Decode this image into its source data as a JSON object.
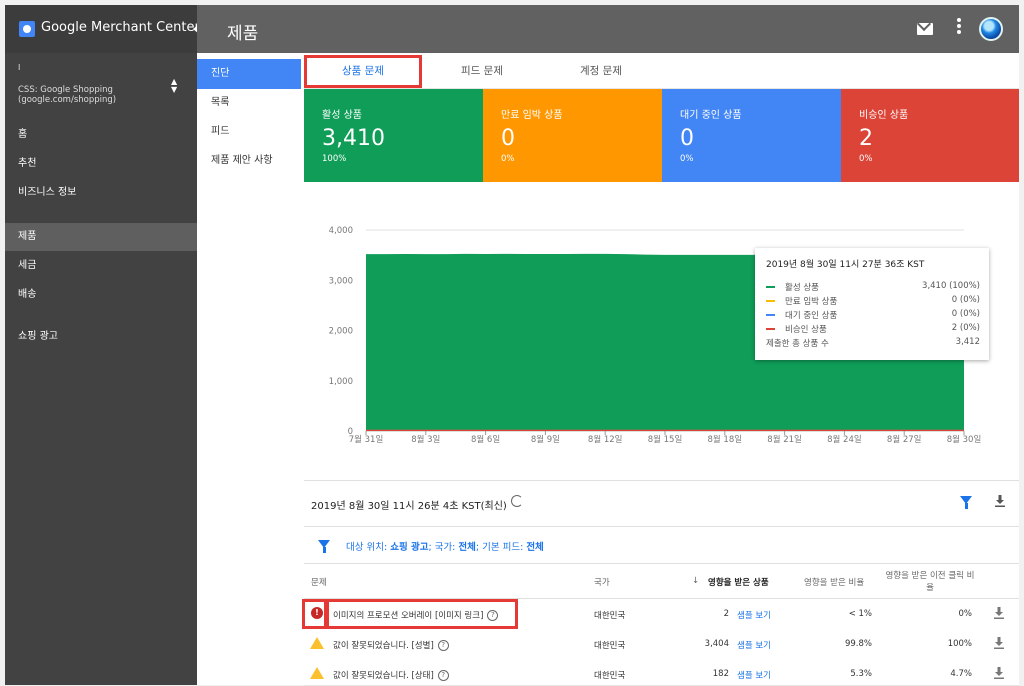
{
  "header": {
    "brand": "Google Merchant Center",
    "title": "제품"
  },
  "account": {
    "line1": "I",
    "line2": "CSS: Google Shopping (google.com/shopping)"
  },
  "leftnav": {
    "items": [
      {
        "label": "홈"
      },
      {
        "label": "추천"
      },
      {
        "label": "비즈니스 정보"
      },
      {
        "label": "제품",
        "active": true
      },
      {
        "label": "세금"
      },
      {
        "label": "배송"
      },
      {
        "label": "쇼핑 광고"
      }
    ]
  },
  "subnav": {
    "items": [
      {
        "label": "진단",
        "active": true
      },
      {
        "label": "목록"
      },
      {
        "label": "피드"
      },
      {
        "label": "제품 제안 사항"
      }
    ]
  },
  "tabs": [
    {
      "label": "상품 문제",
      "active": true
    },
    {
      "label": "피드 문제"
    },
    {
      "label": "계정 문제"
    }
  ],
  "cards": [
    {
      "label": "활성 상품",
      "value": "3,410",
      "pct": "100%",
      "color": "#0f9d58"
    },
    {
      "label": "만료 임박 상품",
      "value": "0",
      "pct": "0%",
      "color": "#ff9800"
    },
    {
      "label": "대기 중인 상품",
      "value": "0",
      "pct": "0%",
      "color": "#4285f4"
    },
    {
      "label": "비승인 상품",
      "value": "2",
      "pct": "0%",
      "color": "#db4437"
    }
  ],
  "chart_data": {
    "type": "area",
    "x": [
      "7월 31일",
      "8월 1일",
      "8월 2일",
      "8월 3일",
      "8월 4일",
      "8월 5일",
      "8월 6일",
      "8월 7일",
      "8월 8일",
      "8월 9일",
      "8월 10일",
      "8월 11일",
      "8월 12일",
      "8월 13일",
      "8월 14일",
      "8월 15일",
      "8월 16일",
      "8월 17일",
      "8월 18일",
      "8월 19일",
      "8월 20일",
      "8월 21일",
      "8월 22일",
      "8월 23일",
      "8월 24일",
      "8월 25일",
      "8월 26일",
      "8월 27일",
      "8월 28일",
      "8월 29일",
      "8월 30일"
    ],
    "x_ticks": [
      "7월 31일",
      "8월 3일",
      "8월 6일",
      "8월 9일",
      "8월 12일",
      "8월 15일",
      "8월 18일",
      "8월 21일",
      "8월 24일",
      "8월 27일",
      "8월 30일"
    ],
    "series": [
      {
        "name": "활성 상품",
        "color": "#0f9d58",
        "values": [
          3520,
          3520,
          3522,
          3520,
          3521,
          3525,
          3523,
          3524,
          3522,
          3522,
          3523,
          3524,
          3525,
          3520,
          3510,
          3505,
          3505,
          3505,
          3506,
          3505,
          3505,
          3505,
          3505,
          3505,
          3505,
          3505,
          3505,
          3505,
          3505,
          3505,
          3410
        ]
      },
      {
        "name": "만료 임박 상품",
        "color": "#fbbc04",
        "values": [
          0,
          0,
          0,
          0,
          0,
          0,
          0,
          0,
          0,
          0,
          0,
          0,
          0,
          0,
          0,
          0,
          0,
          0,
          0,
          0,
          0,
          0,
          0,
          0,
          0,
          0,
          0,
          0,
          0,
          0,
          0
        ]
      },
      {
        "name": "대기 중인 상품",
        "color": "#4285f4",
        "values": [
          0,
          0,
          0,
          0,
          0,
          0,
          0,
          0,
          0,
          0,
          0,
          0,
          0,
          0,
          0,
          0,
          0,
          0,
          0,
          0,
          0,
          0,
          0,
          0,
          0,
          0,
          0,
          0,
          0,
          0,
          0
        ]
      },
      {
        "name": "비승인 상품",
        "color": "#db4437",
        "values": [
          2,
          2,
          2,
          2,
          2,
          2,
          2,
          2,
          2,
          2,
          2,
          2,
          2,
          2,
          2,
          2,
          2,
          2,
          2,
          2,
          2,
          2,
          2,
          2,
          2,
          2,
          2,
          2,
          2,
          2,
          2
        ]
      }
    ],
    "y_ticks": [
      "0",
      "1,000",
      "2,000",
      "3,000",
      "4,000"
    ],
    "ylim": [
      0,
      4000
    ],
    "grid": true
  },
  "tooltip": {
    "title": "2019년 8월 30일 11시 27분 36조 KST",
    "rows": [
      {
        "label": "활성 상품",
        "value": "3,410 (100%)",
        "color": "#0f9d58"
      },
      {
        "label": "만료 임박 상품",
        "value": "0 (0%)",
        "color": "#fbbc04"
      },
      {
        "label": "대기 중인 상품",
        "value": "0 (0%)",
        "color": "#4285f4"
      },
      {
        "label": "비승인 상품",
        "value": "2 (0%)",
        "color": "#db4437"
      },
      {
        "label": "제출한 총 상품 수",
        "value": "3,412",
        "color": ""
      }
    ]
  },
  "report": {
    "timestamp": "2019년 8월 30일 11시 26분 4초 KST(최신)",
    "filter_prefix": "대상 위치: ",
    "filter_dest": "쇼핑 광고",
    "filter_country_label": "; 국가: ",
    "filter_country": "전체",
    "filter_feed_label": "; 기본 피드: ",
    "filter_feed": "전체"
  },
  "table": {
    "headers": {
      "issue": "문제",
      "country": "국가",
      "affected": "영향을 받은 상품",
      "affected_ratio": "영향을 받은 비율",
      "prev_click_ratio": "영향을 받은 이전 클릭 비율"
    },
    "sample_label": "샘플 보기",
    "rows": [
      {
        "severity": "error",
        "issue": "이미지의 프로모션 오버레이 [이미지 링크]",
        "country": "대한민국",
        "count": "2",
        "ratio": "< 1%",
        "click": "0%"
      },
      {
        "severity": "warning",
        "issue": "값이 잘못되었습니다. [성별]",
        "country": "대한민국",
        "count": "3,404",
        "ratio": "99.8%",
        "click": "100%"
      },
      {
        "severity": "warning",
        "issue": "값이 잘못되었습니다. [상태]",
        "country": "대한민국",
        "count": "182",
        "ratio": "5.3%",
        "click": "4.7%"
      }
    ]
  }
}
